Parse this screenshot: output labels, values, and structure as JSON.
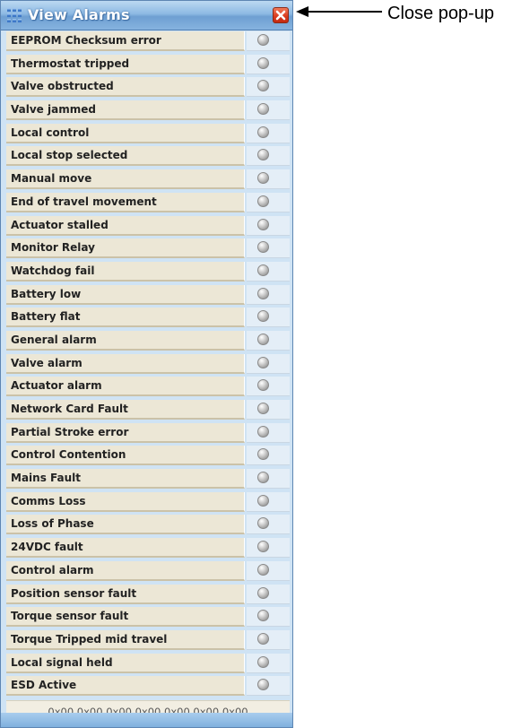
{
  "window": {
    "title": "View Alarms",
    "icons": {
      "title_icon": "grid-icon",
      "close_icon": "close-icon"
    },
    "colors": {
      "title_bar": "#86b3df",
      "close_button": "#d9391d",
      "row_label_bg": "#ece7d6",
      "led_off": "#a8a8a8"
    }
  },
  "alarms": [
    {
      "label": "EEPROM Checksum error",
      "state": "off"
    },
    {
      "label": "Thermostat tripped",
      "state": "off"
    },
    {
      "label": "Valve obstructed",
      "state": "off"
    },
    {
      "label": "Valve jammed",
      "state": "off"
    },
    {
      "label": "Local control",
      "state": "off"
    },
    {
      "label": "Local stop selected",
      "state": "off"
    },
    {
      "label": "Manual move",
      "state": "off"
    },
    {
      "label": "End of travel movement",
      "state": "off"
    },
    {
      "label": "Actuator stalled",
      "state": "off"
    },
    {
      "label": "Monitor Relay",
      "state": "off"
    },
    {
      "label": "Watchdog fail",
      "state": "off"
    },
    {
      "label": "Battery low",
      "state": "off"
    },
    {
      "label": "Battery flat",
      "state": "off"
    },
    {
      "label": "General alarm",
      "state": "off"
    },
    {
      "label": "Valve alarm",
      "state": "off"
    },
    {
      "label": "Actuator alarm",
      "state": "off"
    },
    {
      "label": "Network Card Fault",
      "state": "off"
    },
    {
      "label": "Partial Stroke error",
      "state": "off"
    },
    {
      "label": "Control Contention",
      "state": "off"
    },
    {
      "label": "Mains Fault",
      "state": "off"
    },
    {
      "label": "Comms Loss",
      "state": "off"
    },
    {
      "label": "Loss of Phase",
      "state": "off"
    },
    {
      "label": "24VDC fault",
      "state": "off"
    },
    {
      "label": "Control alarm",
      "state": "off"
    },
    {
      "label": "Position sensor fault",
      "state": "off"
    },
    {
      "label": "Torque sensor fault",
      "state": "off"
    },
    {
      "label": "Torque Tripped mid travel",
      "state": "off"
    },
    {
      "label": "Local signal held",
      "state": "off"
    },
    {
      "label": "ESD Active",
      "state": "off"
    }
  ],
  "hex_status": "0x00 0x00 0x00 0x00 0x00 0x00 0x00",
  "annotation": {
    "text": "Close pop-up",
    "icon": "arrow-left-icon"
  }
}
